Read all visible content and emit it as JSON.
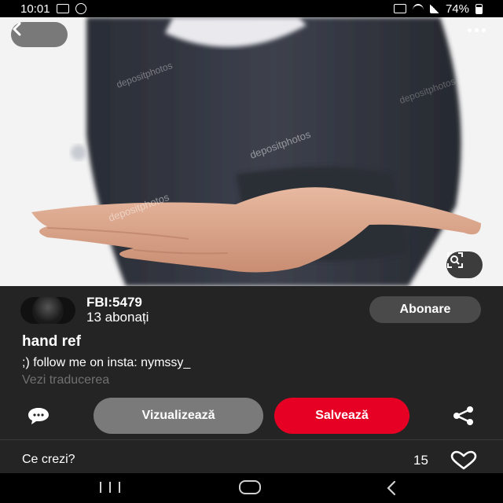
{
  "status_bar": {
    "time": "10:01",
    "battery": "74%"
  },
  "photo": {
    "watermark": "depositphotos"
  },
  "pin": {
    "author": "FBI:5479",
    "followers": "13 abonați",
    "follow_label": "Abonare",
    "title": "hand ref",
    "description": ";) follow me on insta: nymssy_",
    "translate_label": "Vezi traducerea"
  },
  "actions": {
    "view_label": "Vizualizează",
    "save_label": "Salvează"
  },
  "comments": {
    "prompt": "Ce crezi?",
    "like_count": "15"
  },
  "colors": {
    "save": "#e60023",
    "panel": "#242424",
    "view": "#7a7a7a"
  }
}
